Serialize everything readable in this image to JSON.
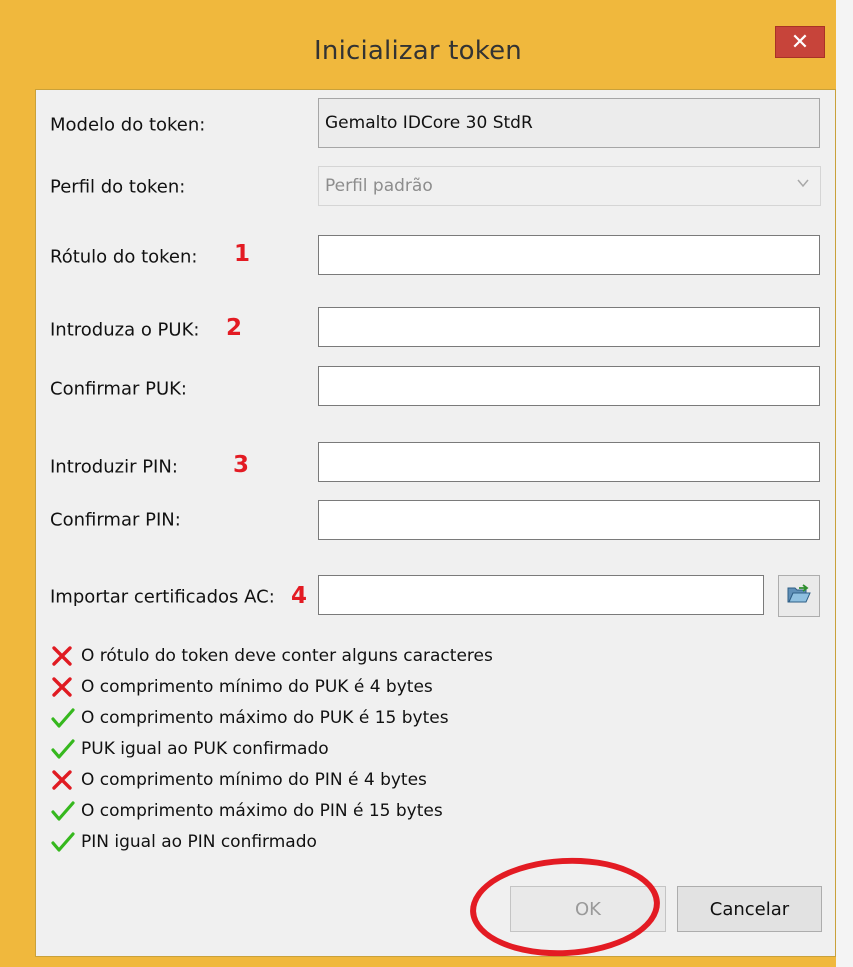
{
  "window": {
    "title": "Inicializar token",
    "close_symbol": "✕"
  },
  "form": {
    "model": {
      "label": "Modelo do token:",
      "value": "Gemalto IDCore 30 StdR"
    },
    "profile": {
      "label": "Perfil do token:",
      "value": "Perfil padrão"
    },
    "label_field": {
      "label": "Rótulo do token:",
      "value": ""
    },
    "puk": {
      "label": "Introduza o PUK:",
      "value": ""
    },
    "puk_confirm": {
      "label": "Confirmar PUK:",
      "value": ""
    },
    "pin": {
      "label": "Introduzir PIN:",
      "value": ""
    },
    "pin_confirm": {
      "label": "Confirmar PIN:",
      "value": ""
    },
    "import_ca": {
      "label": "Importar certificados AC:",
      "value": "",
      "browse_icon": "folder-open-icon"
    }
  },
  "annotations": {
    "n1": "1",
    "n2": "2",
    "n3": "3",
    "n4": "4",
    "color": "#e31b23"
  },
  "validations": [
    {
      "status": "fail",
      "text": "O rótulo do token deve conter alguns caracteres"
    },
    {
      "status": "fail",
      "text": "O comprimento mínimo do PUK é 4 bytes"
    },
    {
      "status": "pass",
      "text": "O comprimento máximo do PUK é 15 bytes"
    },
    {
      "status": "pass",
      "text": "PUK igual ao PUK confirmado"
    },
    {
      "status": "fail",
      "text": "O comprimento mínimo do PIN é 4 bytes"
    },
    {
      "status": "pass",
      "text": "O comprimento máximo do PIN é 15 bytes"
    },
    {
      "status": "pass",
      "text": "PIN igual ao PIN confirmado"
    }
  ],
  "buttons": {
    "ok": "OK",
    "ok_enabled": false,
    "cancel": "Cancelar"
  },
  "colors": {
    "frame": "#f0b83d",
    "close": "#c7443a",
    "fail": "#e01b22",
    "pass": "#36b81e"
  }
}
